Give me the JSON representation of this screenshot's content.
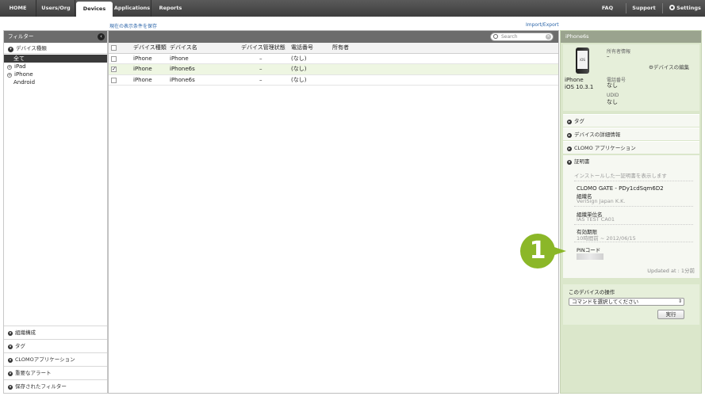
{
  "nav": {
    "tabs": [
      "HOME",
      "Users/Org",
      "Devices",
      "Applications",
      "Reports"
    ],
    "active_tab": "Devices",
    "right": {
      "faq": "FAQ",
      "support": "Support",
      "settings": "Settings"
    }
  },
  "top_links": {
    "save_filter": "現在の表示条件を保存",
    "import_export": "Import/Export"
  },
  "sidebar": {
    "title": "フィルター",
    "device_type_section": "デバイス種類",
    "device_types": [
      "全て",
      "iPad",
      "iPhone",
      "Android"
    ],
    "selected_type": "全て",
    "bottom_sections": [
      "組織構成",
      "タグ",
      "CLOMOアプリケーション",
      "重要なアラート",
      "保存されたフィルター"
    ]
  },
  "search": {
    "placeholder": "Search"
  },
  "table": {
    "columns": [
      "デバイス種類",
      "デバイス名",
      "デバイス管理状態",
      "電話番号",
      "所有者"
    ],
    "rows": [
      {
        "checked": false,
        "type": "iPhone",
        "name": "iPhone",
        "status": "–",
        "phone": "(なし)",
        "owner": ""
      },
      {
        "checked": true,
        "type": "iPhone",
        "name": "iPhone6s",
        "status": "–",
        "phone": "(なし)",
        "owner": ""
      },
      {
        "checked": false,
        "type": "iPhone",
        "name": "iPhone6s",
        "status": "–",
        "phone": "(なし)",
        "owner": ""
      }
    ]
  },
  "detail": {
    "title": "iPhone6s",
    "phone_screen": "iOS",
    "model": "iPhone",
    "os_version": "iOS 10.3.1",
    "owner_label": "所有者情報",
    "owner_value": "–",
    "edit_link": "デバイスの編集",
    "phone_label": "電話番号",
    "phone_value": "なし",
    "udid_label": "UDID",
    "udid_value": "なし",
    "sections": [
      "タグ",
      "デバイスの詳細情報",
      "CLOMO アプリケーション"
    ],
    "cert": {
      "title": "証明書",
      "hint": "インストールした一証明書を表示します",
      "cert_name": "CLOMO GATE - PDy1cdSqm6D2",
      "org_label": "組織名",
      "org_value": "VeriSign Japan K.K.",
      "unit_label": "組織単位名",
      "unit_value": "IAS TEST CA01",
      "expiry_label": "有効期限",
      "expiry_value": "10時間前 ~ 2012/06/15",
      "pin_label": "PINコード",
      "updated": "Updated at : 1分前"
    },
    "ops": {
      "title": "このデバイスの操作",
      "select": "コマンドを選択してください",
      "run": "実行"
    }
  },
  "callout": {
    "number": "1",
    "color": "#8bb728"
  }
}
